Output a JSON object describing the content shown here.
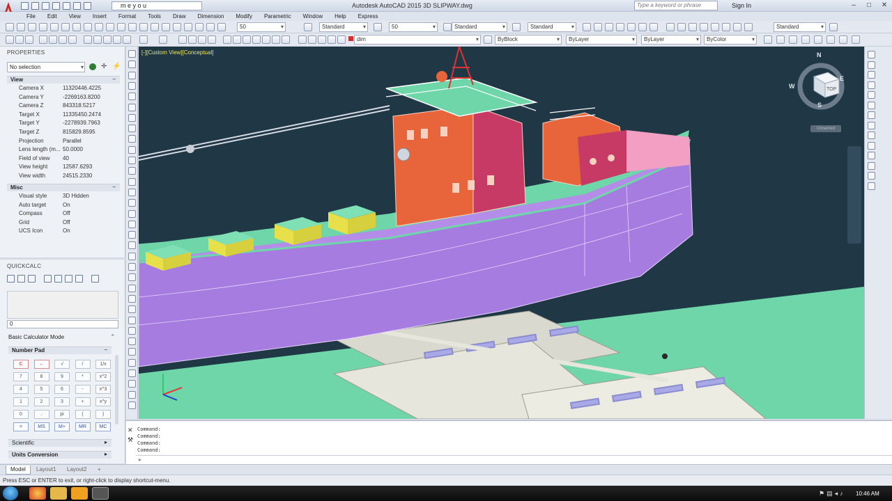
{
  "app": {
    "title": "Autodesk AutoCAD 2015    3D SLIPWAY.dwg",
    "workspace": "m e y o u",
    "search_placeholder": "Type a keyword or phrase",
    "sign_in": "Sign In",
    "accent": "#c62828"
  },
  "menu": [
    "File",
    "Edit",
    "View",
    "Insert",
    "Format",
    "Tools",
    "Draw",
    "Dimension",
    "Modify",
    "Parametric",
    "Window",
    "Help",
    "Express"
  ],
  "toolbar": {
    "combo_50a": "50",
    "text_style": "Standard",
    "combo_50b": "50",
    "dim_style": "Standard",
    "table_style": "Standard",
    "ml_style": "Standard",
    "layer": "dim",
    "color": "ByBlock",
    "linetype": "ByLayer",
    "lineweight": "ByLayer",
    "plotstyle": "ByColor"
  },
  "properties": {
    "title": "PROPERTIES",
    "selection": "No selection",
    "view_section": "View",
    "misc_section": "Misc",
    "view_rows": [
      {
        "k": "Camera X",
        "v": "11320446.4225"
      },
      {
        "k": "Camera Y",
        "v": "-2269163.8200"
      },
      {
        "k": "Camera Z",
        "v": "843318.5217"
      },
      {
        "k": "Target X",
        "v": "11335450.2474"
      },
      {
        "k": "Target Y",
        "v": "-2278939.7963"
      },
      {
        "k": "Target Z",
        "v": "815829.8595"
      },
      {
        "k": "Projection",
        "v": "Parallel"
      },
      {
        "k": "Lens length (m...",
        "v": "50.0000"
      },
      {
        "k": "Field of view",
        "v": "40"
      },
      {
        "k": "View height",
        "v": "12587.6293"
      },
      {
        "k": "View width",
        "v": "24515.2330"
      }
    ],
    "misc_rows": [
      {
        "k": "Visual style",
        "v": "3D Hidden"
      },
      {
        "k": "Auto target",
        "v": "On"
      },
      {
        "k": "Compass",
        "v": "Off"
      },
      {
        "k": "Grid",
        "v": "Off"
      },
      {
        "k": "UCS Icon",
        "v": "On"
      }
    ]
  },
  "quickcalc": {
    "title": "QUICKCALC",
    "input_value": "0",
    "mode": "Basic Calculator Mode",
    "numpad": "Number Pad",
    "keys": [
      "C",
      "←",
      "√",
      "/",
      "1/x",
      "7",
      "8",
      "9",
      "*",
      "x^2",
      "4",
      "5",
      "6",
      "-",
      "x^3",
      "1",
      "2",
      "3",
      "+",
      "x^y",
      "0",
      ".",
      "pi",
      "(",
      ")",
      "=",
      "MS",
      "M+",
      "MR",
      "MC"
    ],
    "scientific": "Scientific",
    "units": "Units Conversion"
  },
  "viewport": {
    "label": "[-][Custom View][Conceptual]",
    "viewcube_top": "TOP",
    "compass_n": "N",
    "compass_s": "S",
    "compass_w": "W",
    "compass_e": "E",
    "unnamed": "Unnamed"
  },
  "command": {
    "lines": [
      "Command:",
      "Command:",
      "Command:",
      "Command:"
    ]
  },
  "tabs": [
    "Model",
    "Layout1",
    "Layout2"
  ],
  "status": "Press ESC or ENTER to exit, or right-click to display shortcut-menu.",
  "taskbar": {
    "clock": "10:46 AM"
  }
}
